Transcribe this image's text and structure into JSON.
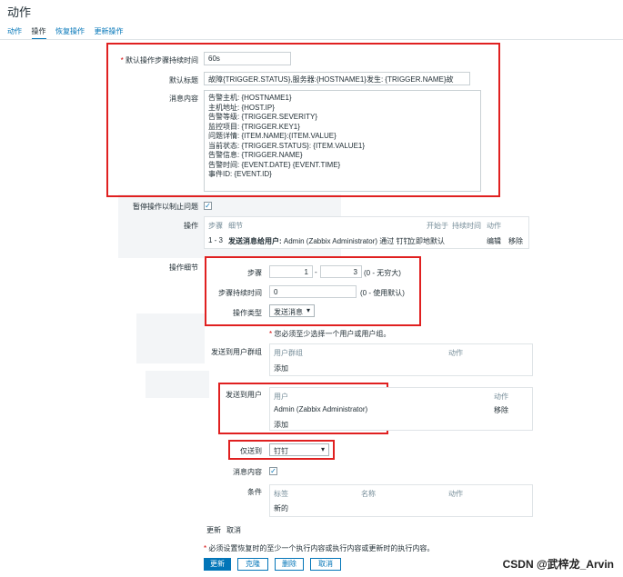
{
  "window": {
    "title": "动作"
  },
  "tabs": [
    {
      "label": "动作"
    },
    {
      "label": "操作"
    },
    {
      "label": "恢复操作"
    },
    {
      "label": "更新操作"
    }
  ],
  "form": {
    "duration_label": "默认操作步骤持续时间",
    "duration_value": "60s",
    "subject_label": "默认标题",
    "subject_value": "故障{TRIGGER.STATUS},服务器:{HOSTNAME1}发生: {TRIGGER.NAME}故",
    "message_label": "消息内容",
    "message_lines": [
      "告警主机: {HOSTNAME1}",
      "主机地址: {HOST.IP}",
      "告警等级: {TRIGGER.SEVERITY}",
      "监控项目: {TRIGGER.KEY1}",
      "问题详情: {ITEM.NAME}:{ITEM.VALUE}",
      "当前状态: {TRIGGER.STATUS}: {ITEM.VALUE1}",
      "告警信息: {TRIGGER.NAME}",
      "告警时间: {EVENT.DATE} {EVENT.TIME}",
      "事件ID: {EVENT.ID}"
    ],
    "pause_label": "暂停操作以制止问题",
    "operations_label": "操作",
    "operations_table": {
      "headers": [
        "步骤",
        "细节",
        "开始于",
        "持续时间",
        "动作"
      ],
      "row": {
        "steps": "1 - 3",
        "detail_bold": "发送消息给用户:",
        "detail_rest": " Admin (Zabbix Administrator) 通过 钉钉",
        "start": "立即地",
        "duration": "默认",
        "edit": "编辑",
        "remove": "移除"
      }
    },
    "op_details_label": "操作细节",
    "steps_label": "步骤",
    "steps_from": "1",
    "steps_dash": "-",
    "steps_to": "3",
    "steps_hint": "(0 - 无穷大)",
    "step_duration_label": "步骤持续时间",
    "step_duration_value": "0",
    "step_duration_hint": "(0 - 使用默认)",
    "op_type_label": "操作类型",
    "op_type_value": "发送消息",
    "must_select_note": "您必须至少选择一个用户或用户组。",
    "user_groups_label": "发送到用户群组",
    "user_groups_headers": [
      "用户群组",
      "动作"
    ],
    "user_groups_add": "添加",
    "users_label": "发送到用户",
    "users_headers": [
      "用户",
      "动作"
    ],
    "users_row": "Admin (Zabbix Administrator)",
    "users_remove": "移除",
    "users_add": "添加",
    "send_only_label": "仅送到",
    "send_only_value": "钉钉",
    "default_message_label": "消息内容",
    "conditions_label": "条件",
    "conditions_headers": [
      "标签",
      "名称",
      "动作"
    ],
    "conditions_new": "新的",
    "inline_update": "更新",
    "inline_cancel": "取消",
    "bottom_note": "必须设置恢复时的至少一个执行内容或执行内容或更新时的执行内容。",
    "buttons": {
      "update": "更新",
      "clone": "克隆",
      "delete": "删除",
      "cancel": "取消"
    }
  },
  "watermark": "CSDN @武梓龙_Arvin",
  "colors": {
    "link": "#0275b8",
    "highlight": "#e02020"
  }
}
